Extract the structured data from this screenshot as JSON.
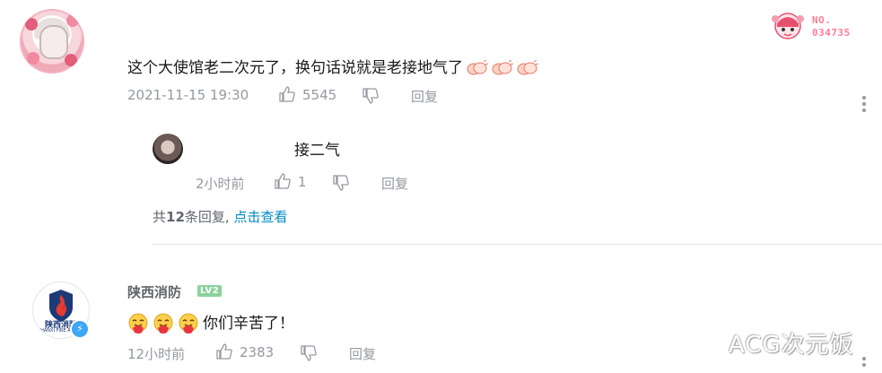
{
  "comment1": {
    "text": "这个大使馆老二次元了，换句话说就是老接地气了",
    "emojis": [
      "clap-emoji",
      "clap-emoji",
      "clap-emoji"
    ],
    "timestamp": "2021-11-15 19:30",
    "likes": "5545",
    "reply_label": "回复",
    "badge_text_line1": "NO.",
    "badge_text_line2": "034735"
  },
  "reply1": {
    "text": "接二气",
    "timestamp": "2小时前",
    "likes": "1",
    "reply_label": "回复"
  },
  "reply_summary": {
    "prefix": "共",
    "count": "12",
    "suffix": "条回复,",
    "link": "点击查看"
  },
  "comment2": {
    "username": "陕西消防",
    "level": "LV2",
    "avatar_text": "陕西消防",
    "avatar_subtext": "HANXI FIRE AND...",
    "emojis": [
      "hug-emoji",
      "hug-emoji",
      "hug-emoji"
    ],
    "text": "你们辛苦了！",
    "timestamp": "12小时前",
    "likes": "2383",
    "reply_label": "回复"
  },
  "watermark": "ACG次元饭",
  "colors": {
    "meta_gray": "#9499a0",
    "link_blue": "#008ac5",
    "badge_pink": "#ff7c98",
    "level_green": "#8bd29b"
  }
}
